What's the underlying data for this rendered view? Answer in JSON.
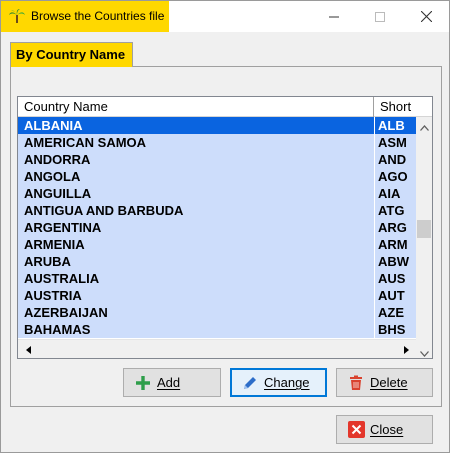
{
  "window": {
    "title": "Browse the Countries file"
  },
  "tab": {
    "label": "By Country Name"
  },
  "list": {
    "columns": [
      "Country Name",
      "Short"
    ],
    "rows": [
      {
        "name": "ALBANIA",
        "short": "ALB",
        "selected": true
      },
      {
        "name": "AMERICAN SAMOA",
        "short": "ASM"
      },
      {
        "name": "ANDORRA",
        "short": "AND"
      },
      {
        "name": "ANGOLA",
        "short": "AGO"
      },
      {
        "name": "ANGUILLA",
        "short": "AIA"
      },
      {
        "name": "ANTIGUA AND BARBUDA",
        "short": "ATG"
      },
      {
        "name": "ARGENTINA",
        "short": "ARG"
      },
      {
        "name": "ARMENIA",
        "short": "ARM"
      },
      {
        "name": "ARUBA",
        "short": "ABW"
      },
      {
        "name": "AUSTRALIA",
        "short": "AUS"
      },
      {
        "name": "AUSTRIA",
        "short": "AUT"
      },
      {
        "name": "AZERBAIJAN",
        "short": "AZE"
      },
      {
        "name": "BAHAMAS",
        "short": "BHS"
      }
    ]
  },
  "buttons": {
    "add": "Add",
    "change": "Change",
    "delete": "Delete",
    "close": "Close"
  },
  "colors": {
    "title_accent": "#ffd800",
    "row_background": "#cdddfb",
    "row_selected": "#0a64e0",
    "add_icon": "#2e9e4a",
    "change_icon": "#2d6ec9",
    "delete_icon": "#d9432f",
    "close_icon": "#e3362b"
  },
  "icons": {
    "app": "palm-tree-icon",
    "minimize": "minimize-icon",
    "maximize": "maximize-icon",
    "close_window": "close-icon",
    "add": "plus-icon",
    "change": "pencil-icon",
    "delete": "trash-icon",
    "close": "close-x-icon"
  }
}
